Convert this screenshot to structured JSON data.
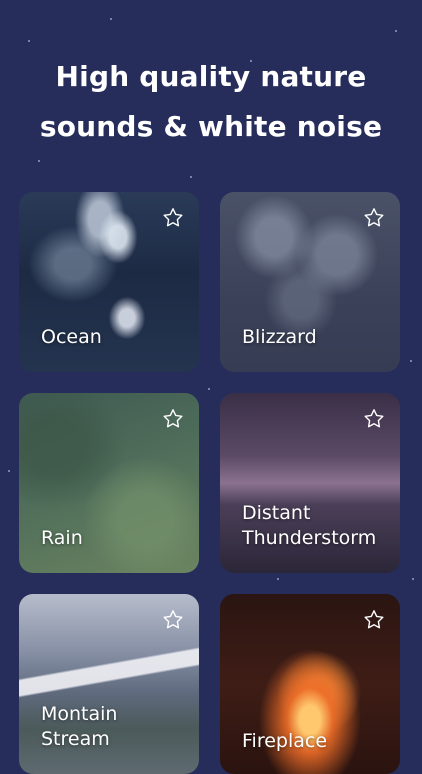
{
  "header": {
    "line1": "High quality nature",
    "line2": "sounds & white noise"
  },
  "sounds": [
    {
      "name": "Ocean",
      "icon": "star-outline-icon"
    },
    {
      "name": "Blizzard",
      "icon": "star-outline-icon"
    },
    {
      "name": "Rain",
      "icon": "star-outline-icon"
    },
    {
      "name_line1": "Distant",
      "name_line2": "Thunderstorm",
      "icon": "star-outline-icon"
    },
    {
      "name_line1": "Montain",
      "name_line2": "Stream",
      "icon": "star-outline-icon"
    },
    {
      "name": "Fireplace",
      "icon": "star-outline-icon"
    }
  ],
  "colors": {
    "background": "#262d5a",
    "text": "#ffffff"
  }
}
